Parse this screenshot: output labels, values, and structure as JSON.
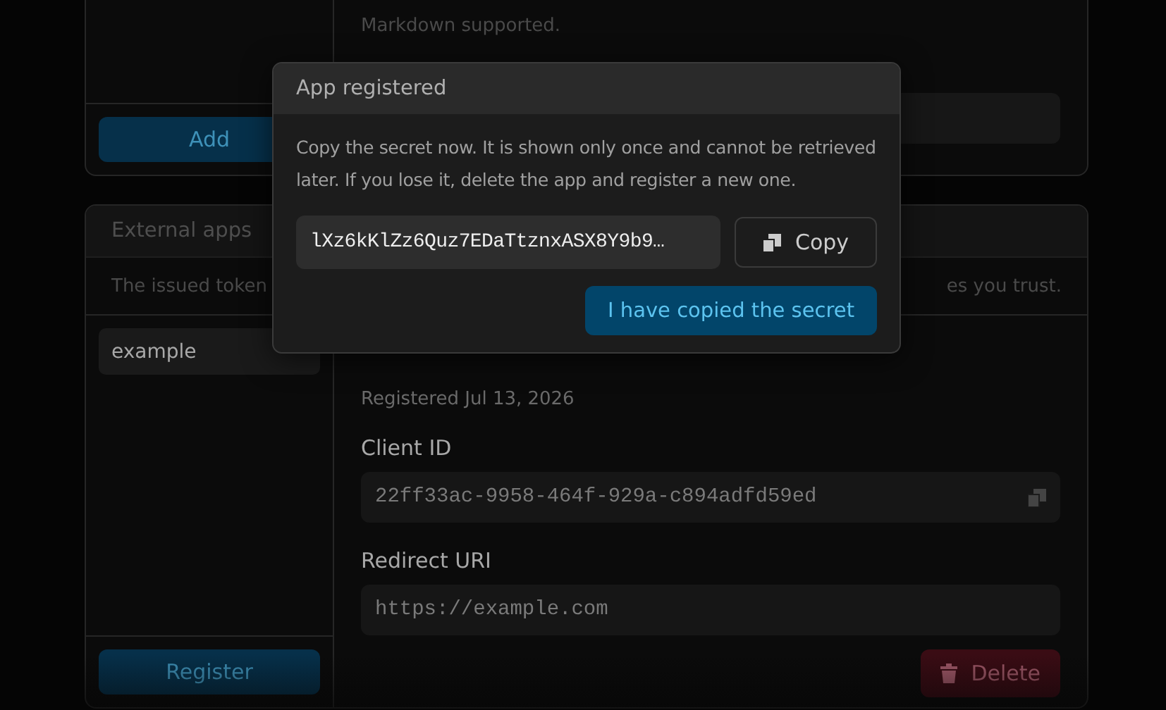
{
  "top_card": {
    "add_button": "Add",
    "hint": "Markdown supported."
  },
  "external_apps": {
    "title": "External apps",
    "description_start": "The issued token",
    "description_end": "es you trust.",
    "apps": [
      {
        "name": "example",
        "selected": true
      }
    ],
    "register_button": "Register",
    "detail": {
      "registered": "Registered Jul 13, 2026",
      "client_id_label": "Client ID",
      "client_id": "22ff33ac-9958-464f-929a-c894adfd59ed",
      "redirect_label": "Redirect URI",
      "redirect_uri": "https://example.com",
      "delete_button": "Delete"
    }
  },
  "dialog": {
    "title": "App registered",
    "message": "Copy the secret now. It is shown only once and cannot be retrieved later. If you lose it, delete the app and register a new one.",
    "secret": "lXz6kKlZz6Quz7EDaTtznxASX8Y9b9…",
    "copy_button": "Copy",
    "confirm_button": "I have copied the secret"
  }
}
